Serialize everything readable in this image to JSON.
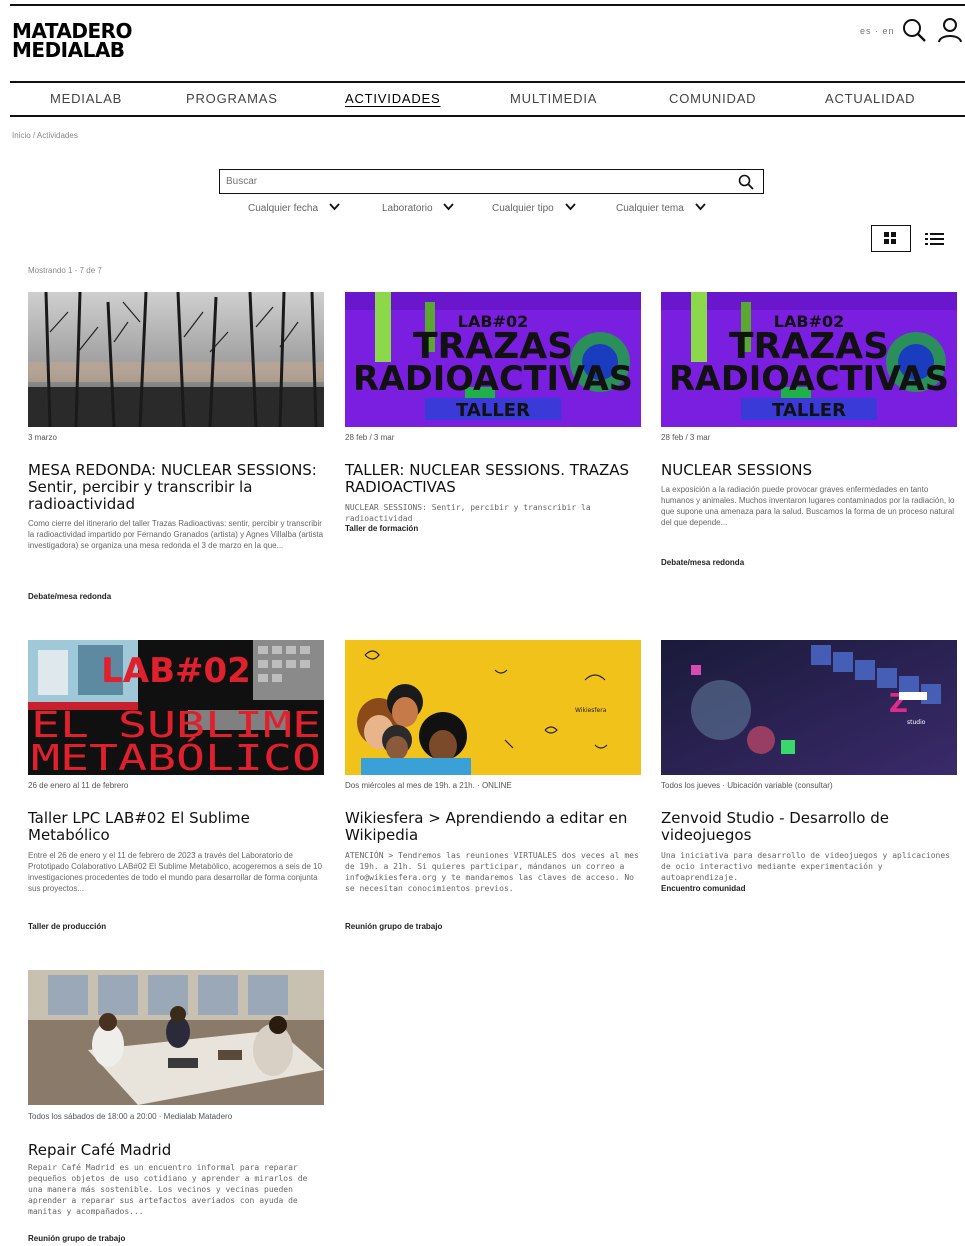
{
  "header": {
    "logo_line1": "MATADERO",
    "logo_line2": "MEDIALAB",
    "lang": "es · en"
  },
  "nav": {
    "items": [
      "MEDIALAB",
      "PROGRAMAS",
      "ACTIVIDADES",
      "MULTIMEDIA",
      "COMUNIDAD",
      "ACTUALIDAD"
    ],
    "active": "ACTIVIDADES"
  },
  "breadcrumb": "Inicio / Actividades",
  "search": {
    "placeholder": "Buscar"
  },
  "filters": [
    "Cualquier fecha",
    "Laboratorio",
    "Cualquier tipo",
    "Cualquier tema"
  ],
  "results_count": "Mostrando 1 - 7 de 7",
  "cards": [
    {
      "date": "3 marzo",
      "title": "MESA REDONDA: NUCLEAR SESSIONS: Sentir, percibir y transcribir la radioactividad",
      "desc": "Como cierre del itinerario del taller Trazas Radioactivas: sentir, percibir y transcribir la radioactividad impartido por Fernando Granados (artista) y Agnes Villalba (artista investigadora) se organiza una mesa redonda el 3 de marzo en la que...",
      "category": "Debate/mesa redonda"
    },
    {
      "date": "28 feb / 3 mar",
      "title": "TALLER: NUCLEAR SESSIONS. TRAZAS RADIOACTIVAS",
      "desc": "NUCLEAR SESSIONS: Sentir, percibir y transcribir la radioactividad",
      "category": "Taller de formación",
      "thumb_lab": "LAB#02",
      "thumb_l1": "TRAZAS",
      "thumb_l2": "RADIOACTIVAS",
      "thumb_l3": "TALLER"
    },
    {
      "date": "28 feb / 3 mar",
      "title": "NUCLEAR SESSIONS",
      "desc": "La exposición a la radiación puede provocar graves enfermedades en tanto humanos y animales. Muchos inventaron lugares contaminados por la radiación, lo que supone una amenaza para la salud. Buscamos la forma de un proceso natural del que depende...",
      "category": "Debate/mesa redonda",
      "thumb_lab": "LAB#02",
      "thumb_l1": "TRAZAS",
      "thumb_l2": "RADIOACTIVAS",
      "thumb_l3": "TALLER"
    },
    {
      "date": "26 de enero al 11 de febrero",
      "title": "Taller LPC LAB#02 El Sublime Metabólico",
      "desc": "Entre el 26 de enero y el 11 de febrero de 2023 a través del Laboratorio de Prototipado Colaborativo LAB#02 El Sublime Metabólico, acogeremos a seis de 10 investigaciones procedentes de todo el mundo para desarrollar de forma conjunta sus proyectos...",
      "category": "Taller de producción",
      "thumb_lab": "LAB#02",
      "thumb_l1": "EL SUBLIME",
      "thumb_l2": "METABÓLICO"
    },
    {
      "date": "Dos miércoles al mes de 19h. a 21h.   ·   ONLINE",
      "title": "Wikiesfera > Aprendiendo a editar en Wikipedia",
      "desc": "ATENCIÓN > Tendremos las reuniones VIRTUALES dos veces al mes de 19h. a 21h. Si quieres participar, mándanos un correo a info@wikiesfera.org y te mandaremos las claves de acceso. No se necesitan conocimientos previos.",
      "category": "Reunión grupo de trabajo"
    },
    {
      "date": "Todos los jueves   ·   Ubicación variable (consultar)",
      "title": "Zenvoid Studio - Desarrollo de videojuegos",
      "desc": "Una iniciativa para desarrollo de videojuegos y aplicaciones de ocio interactivo mediante experimentación y autoaprendizaje.",
      "category": "Encuentro comunidad"
    },
    {
      "date": "Todos los sábados de 18:00 a 20:00   ·   Medialab Matadero",
      "title": "Repair Café Madrid",
      "desc": "Repair Café Madrid es un encuentro informal para reparar pequeños objetos de uso cotidiano y aprender a mirarlos de una manera más sostenible. Los vecinos y vecinas pueden aprender a reparar sus artefactos averiados con ayuda de manitas y acompañados...",
      "category": "Reunión grupo de trabajo"
    }
  ]
}
